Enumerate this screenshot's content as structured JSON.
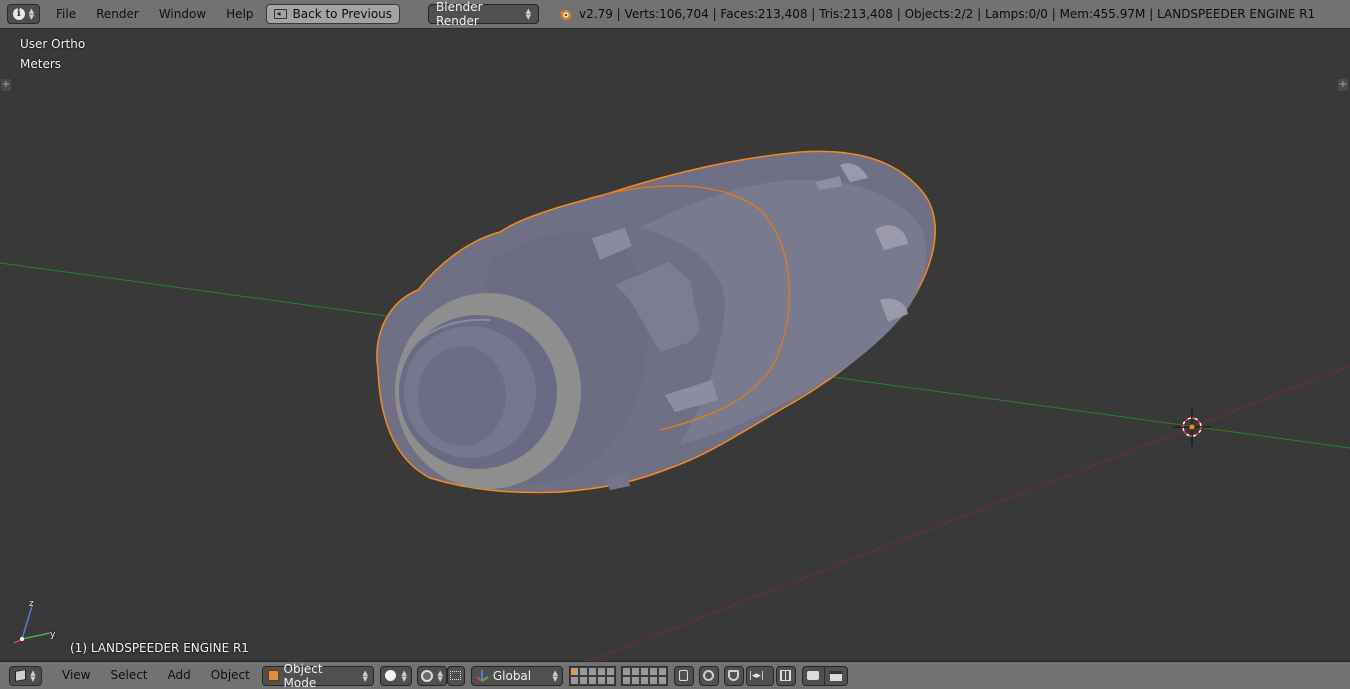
{
  "header": {
    "menus": [
      "File",
      "Render",
      "Window",
      "Help"
    ],
    "back_button": "Back to Previous",
    "render_engine": "Blender Render",
    "stats": "v2.79 | Verts:106,704 | Faces:213,408 | Tris:213,408 | Objects:2/2 | Lamps:0/0 | Mem:455.97M | LANDSPEEDER ENGINE R1"
  },
  "viewport": {
    "view_name": "User Ortho",
    "units": "Meters",
    "object_label": "(1) LANDSPEEDER ENGINE R1",
    "axis_labels": {
      "z": "z",
      "y": "y"
    }
  },
  "footer": {
    "menus": [
      "View",
      "Select",
      "Add",
      "Object"
    ],
    "mode": "Object Mode",
    "orientation": "Global"
  },
  "colors": {
    "header_bg": "#727272",
    "viewport_bg": "#393939",
    "selection_outline": "#f28a1e",
    "x_axis": "#8a2e2e",
    "y_axis": "#2f7a2f",
    "mesh": "#7f7f93"
  }
}
